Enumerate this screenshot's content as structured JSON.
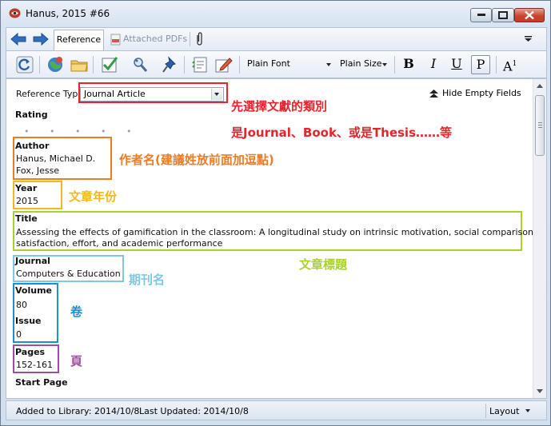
{
  "window": {
    "title": "Hanus, 2015 #66"
  },
  "tabs": {
    "reference": "Reference",
    "attached_pdfs": "Attached PDFs"
  },
  "toolbar": {
    "font": "Plain Font",
    "size": "Plain Size",
    "bold": "B",
    "italic": "I",
    "underline": "U",
    "plain": "P",
    "superscript": "A",
    "superscript_sup": "1"
  },
  "reference_type": {
    "label": "Reference Type",
    "value": "Journal Article",
    "hide_empty": "Hide Empty Fields"
  },
  "fields": {
    "rating": {
      "label": "Rating",
      "dots": "• • • • •"
    },
    "author": {
      "label": "Author",
      "line1": "Hanus, Michael D.",
      "line2": "Fox, Jesse"
    },
    "year": {
      "label": "Year",
      "value": "2015"
    },
    "title": {
      "label": "Title",
      "line1": "Assessing the effects of gamification in the classroom: A longitudinal study on intrinsic motivation, social comparison,",
      "line2": "satisfaction, effort, and academic performance"
    },
    "journal": {
      "label": "Journal",
      "value": "Computers & Education"
    },
    "volume": {
      "label": "Volume",
      "value": "80"
    },
    "issue": {
      "label": "Issue",
      "value": "0"
    },
    "pages": {
      "label": "Pages",
      "value": "152-161"
    },
    "start_page": {
      "label": "Start Page"
    }
  },
  "annotations": {
    "reftype_line1": "先選擇文獻的類別",
    "reftype_line2": "是Journal、Book、或是Thesis……等",
    "author": "作者名(建議姓放前面加逗點)",
    "year": "文章年份",
    "title": "文章標題",
    "journal": "期刊名",
    "volume": "卷",
    "pages": "頁"
  },
  "colors": {
    "red": "#e8232b",
    "orange": "#f07b22",
    "yellow": "#f2b81e",
    "green": "#a9d12a",
    "lightblue": "#7ec8e3",
    "blue": "#1a8fd1",
    "purple": "#9b4fa0"
  },
  "status": {
    "added": "Added to Library: 2014/10/8",
    "updated": "Last Updated: 2014/10/8",
    "layout": "Layout"
  }
}
